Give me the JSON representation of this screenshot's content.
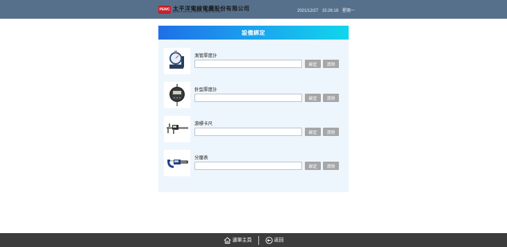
{
  "header": {
    "logo_badge": "PEWC",
    "logo_cn": "太平洋電線電纜股份有限公司",
    "logo_en": "PACIFIC ELECTRIC WIRE & CABLE CO., LTD.",
    "date": "2021/12/27",
    "time": "15:26:19",
    "weekday": "星期一"
  },
  "panel": {
    "title": "設備綁定",
    "bind_label": "綁定",
    "clear_label": "清除",
    "devices": [
      {
        "label": "測管厚度計",
        "value": "",
        "icon": "dial-thickness-gauge-icon"
      },
      {
        "label": "針型厚度計",
        "value": "",
        "icon": "digital-indicator-icon"
      },
      {
        "label": "游標卡尺",
        "value": "",
        "icon": "caliper-icon"
      },
      {
        "label": "分厘表",
        "value": "",
        "icon": "micrometer-icon"
      }
    ]
  },
  "footer": {
    "home_label": "選單主頁",
    "back_label": "返回"
  }
}
